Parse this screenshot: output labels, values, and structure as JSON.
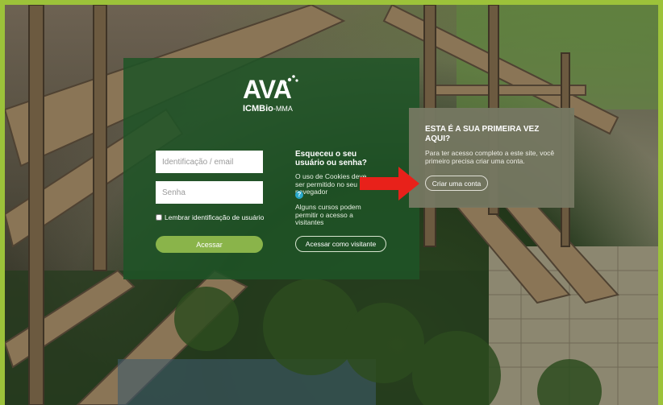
{
  "logo": {
    "main": "AVA",
    "org": "ICMBio",
    "suffix": "-MMA"
  },
  "login": {
    "username_placeholder": "Identificação / email",
    "password_placeholder": "Senha",
    "remember_label": "Lembrar identificação de usuário",
    "submit_label": "Acessar"
  },
  "help": {
    "forgot_title": "Esqueceu o seu usuário ou senha?",
    "cookies_text": "O uso de Cookies deve ser permitido no seu navegador",
    "guest_text": "Alguns cursos podem permitir o acesso a visitantes",
    "guest_button": "Acessar como visitante"
  },
  "first_time": {
    "title": "ESTA É A SUA PRIMEIRA VEZ AQUI?",
    "text": "Para ter acesso completo a este site, você primeiro precisa criar uma conta.",
    "button": "Criar uma conta"
  },
  "colors": {
    "page_border": "#9cc23a",
    "panel_green": "#1e5426",
    "button_green": "#8ab44a",
    "info_panel": "#767862",
    "arrow_red": "#e8211a"
  },
  "icons": {
    "help": "question-circle-icon",
    "pointer": "red-arrow-icon"
  }
}
